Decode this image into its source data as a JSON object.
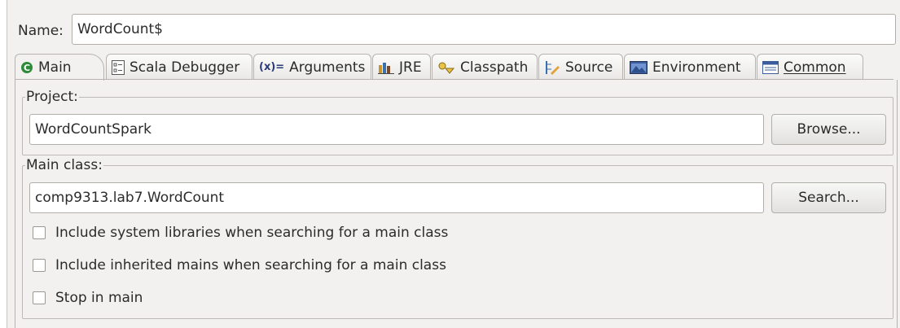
{
  "name_label": "Name:",
  "name_value": "WordCount$",
  "tabs": [
    {
      "label": "Main",
      "icon": "main-class-icon"
    },
    {
      "label": "Scala Debugger",
      "icon": "debugger-icon"
    },
    {
      "label": "Arguments",
      "icon": "arguments-icon"
    },
    {
      "label": "JRE",
      "icon": "jre-icon"
    },
    {
      "label": "Classpath",
      "icon": "classpath-icon"
    },
    {
      "label": "Source",
      "icon": "source-icon"
    },
    {
      "label": "Environment",
      "icon": "environment-icon"
    },
    {
      "label": "Common",
      "icon": "common-icon"
    }
  ],
  "project": {
    "legend": "Project:",
    "value": "WordCountSpark",
    "browse_label": "Browse..."
  },
  "main_class": {
    "legend": "Main class:",
    "value": "comp9313.lab7.WordCount",
    "search_label": "Search...",
    "options": [
      {
        "label": "Include system libraries when searching for a main class",
        "checked": false
      },
      {
        "label": "Include inherited mains when searching for a main class",
        "checked": false
      },
      {
        "label": "Stop in main",
        "checked": false
      }
    ]
  },
  "colors": {
    "main_icon": "#2e8b3a",
    "panel_bg": "#f2f1f0"
  }
}
